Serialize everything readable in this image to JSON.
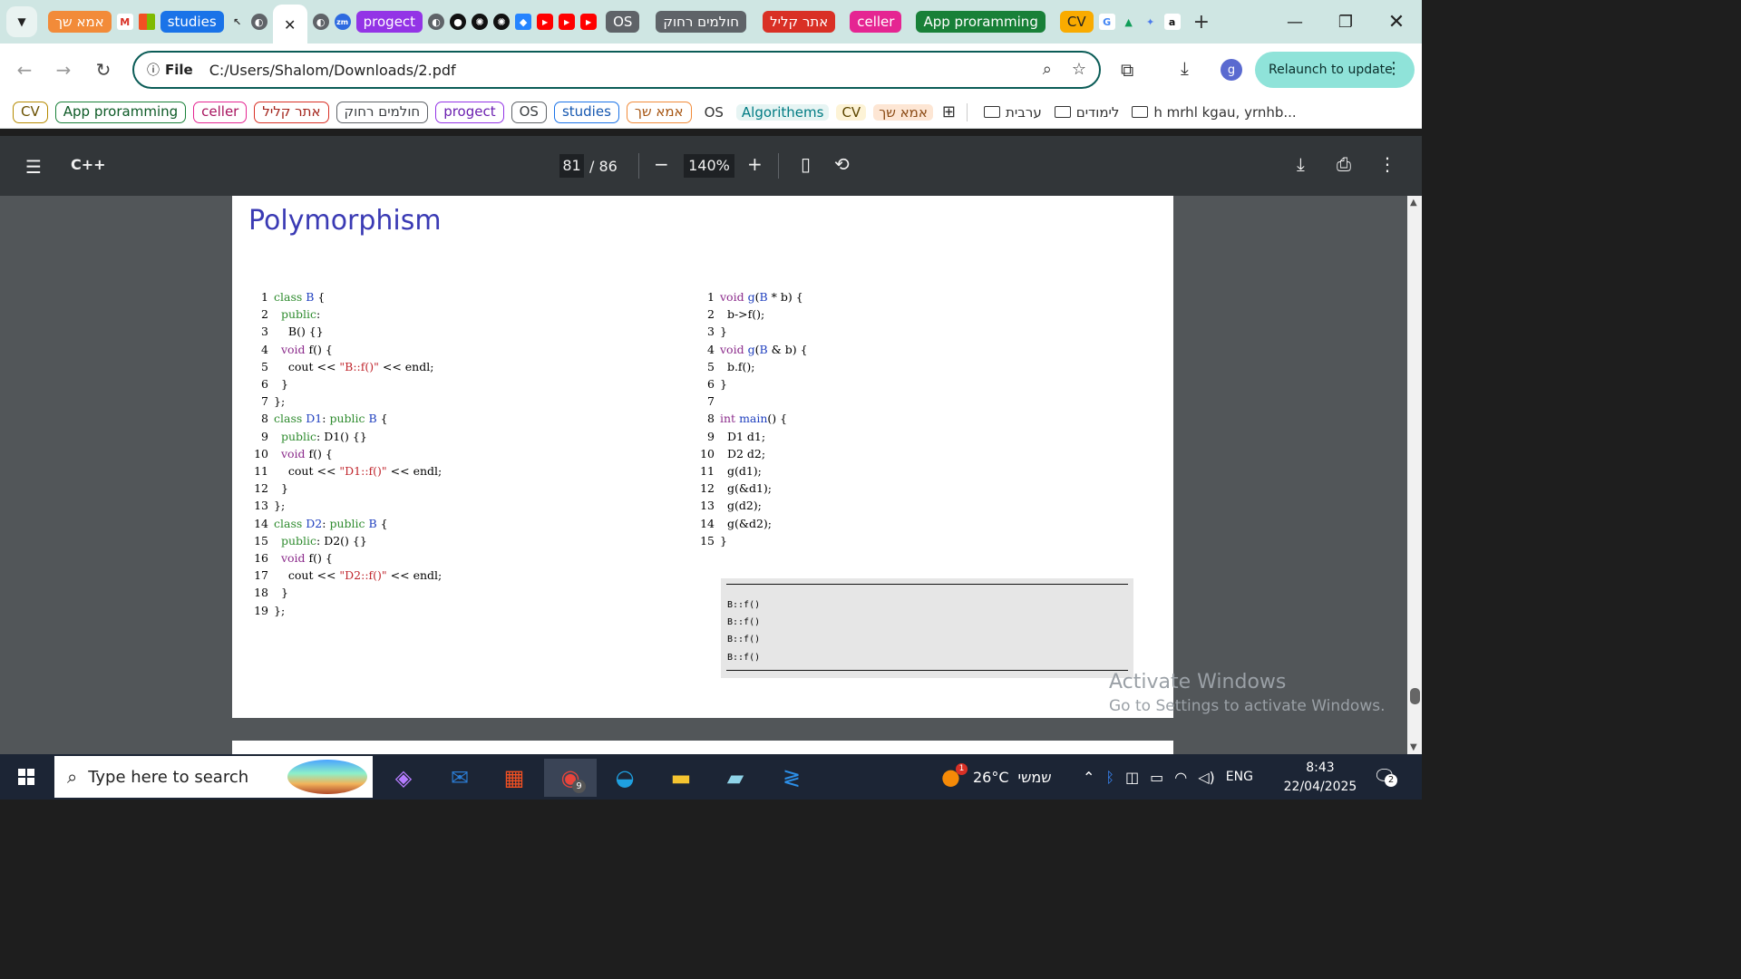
{
  "browser": {
    "tabs": [
      {
        "label": "אמא שך",
        "color": "#f28b39",
        "text": "#fff"
      },
      {
        "label": "studies",
        "color": "#1a73e8",
        "text": "#fff"
      },
      {
        "label": "progect",
        "color": "#9334e6",
        "text": "#fff"
      },
      {
        "label": "OS",
        "color": "#5f6368",
        "text": "#fff"
      },
      {
        "label": "חולמים רחוק",
        "color": "#5f6368",
        "text": "#fff"
      },
      {
        "label": "אתר קליל",
        "color": "#d93025",
        "text": "#fff"
      },
      {
        "label": "celler",
        "color": "#e52592",
        "text": "#fff"
      },
      {
        "label": "App proramming",
        "color": "#188038",
        "text": "#fff"
      },
      {
        "label": "CV",
        "color": "#f9ab00",
        "text": "#222"
      }
    ],
    "url_scheme": "File",
    "url": "C:/Users/Shalom/Downloads/2.pdf",
    "relaunch_label": "Relaunch to update",
    "avatar_letter": "g",
    "bookmarks": [
      {
        "label": "CV",
        "color": "#b58a00",
        "type": "pill"
      },
      {
        "label": "App proramming",
        "color": "#188038",
        "type": "pill"
      },
      {
        "label": "celler",
        "color": "#e52592",
        "type": "pill"
      },
      {
        "label": "אתר קליל",
        "color": "#d93025",
        "type": "pill"
      },
      {
        "label": "חולמים רחוק",
        "color": "#5f6368",
        "type": "pill"
      },
      {
        "label": "progect",
        "color": "#9334e6",
        "type": "pill"
      },
      {
        "label": "OS",
        "color": "#5f6368",
        "type": "pill"
      },
      {
        "label": "studies",
        "color": "#1a73e8",
        "type": "pill"
      },
      {
        "label": "אמא שך",
        "color": "#f28b39",
        "type": "pill"
      },
      {
        "label": "OS",
        "color": "#5f6368",
        "type": "plain"
      },
      {
        "label": "Algorithems",
        "color": "#007b83",
        "type": "plain"
      },
      {
        "label": "CV",
        "color": "#b58a00",
        "type": "plain"
      },
      {
        "label": "אמא שך",
        "color": "#f28b39",
        "type": "plain"
      }
    ],
    "folders": [
      "ערבית",
      "לימודים",
      "h mrhl kgau, yrnhb..."
    ]
  },
  "pdf": {
    "doc_title": "C++",
    "current_page": "81",
    "total_pages": "/ 86",
    "zoom": "140%",
    "slide_title": "Polymorphism",
    "left_code": [
      {
        "n": "1",
        "text": "class B {"
      },
      {
        "n": "2",
        "text": "  public:"
      },
      {
        "n": "3",
        "text": "    B() {}"
      },
      {
        "n": "4",
        "text": "  void f() {"
      },
      {
        "n": "5",
        "text": "    cout << \"B::f()\" << endl;"
      },
      {
        "n": "6",
        "text": "  }"
      },
      {
        "n": "7",
        "text": "};"
      },
      {
        "n": "8",
        "text": "class D1: public B {"
      },
      {
        "n": "9",
        "text": "  public: D1() {}"
      },
      {
        "n": "10",
        "text": "  void f() {"
      },
      {
        "n": "11",
        "text": "    cout << \"D1::f()\" << endl;"
      },
      {
        "n": "12",
        "text": "  }"
      },
      {
        "n": "13",
        "text": "};"
      },
      {
        "n": "14",
        "text": "class D2: public B {"
      },
      {
        "n": "15",
        "text": "  public: D2() {}"
      },
      {
        "n": "16",
        "text": "  void f() {"
      },
      {
        "n": "17",
        "text": "    cout << \"D2::f()\" << endl;"
      },
      {
        "n": "18",
        "text": "  }"
      },
      {
        "n": "19",
        "text": "};"
      }
    ],
    "right_code": [
      {
        "n": "1",
        "text": "void g(B * b) {"
      },
      {
        "n": "2",
        "text": "  b->f();"
      },
      {
        "n": "3",
        "text": "}"
      },
      {
        "n": "4",
        "text": "void g(B & b) {"
      },
      {
        "n": "5",
        "text": "  b.f();"
      },
      {
        "n": "6",
        "text": "}"
      },
      {
        "n": "7",
        "text": ""
      },
      {
        "n": "8",
        "text": "int main() {"
      },
      {
        "n": "9",
        "text": "  D1 d1;"
      },
      {
        "n": "10",
        "text": "  D2 d2;"
      },
      {
        "n": "11",
        "text": "  g(d1);"
      },
      {
        "n": "12",
        "text": "  g(&d1);"
      },
      {
        "n": "13",
        "text": "  g(d2);"
      },
      {
        "n": "14",
        "text": "  g(&d2);"
      },
      {
        "n": "15",
        "text": "}"
      }
    ],
    "output_lines": [
      "B::f()",
      "B::f()",
      "B::f()",
      "B::f()"
    ]
  },
  "watermark": {
    "line1": "Activate Windows",
    "line2": "Go to Settings to activate Windows."
  },
  "taskbar": {
    "search_placeholder": "Type here to search",
    "temperature": "26°C",
    "weather_label": "שמשי",
    "language": "ENG",
    "time": "8:43",
    "date": "22/04/2025",
    "notification_count": "2",
    "weather_badge": "1",
    "chrome_badge": "9"
  },
  "colors": {
    "keyword_green": "#2e8b2e",
    "keyword_purple": "#8b2b8b",
    "identifier_blue": "#1f3fbf",
    "string_red": "#c0262d",
    "slide_title": "#3a3ab4"
  }
}
